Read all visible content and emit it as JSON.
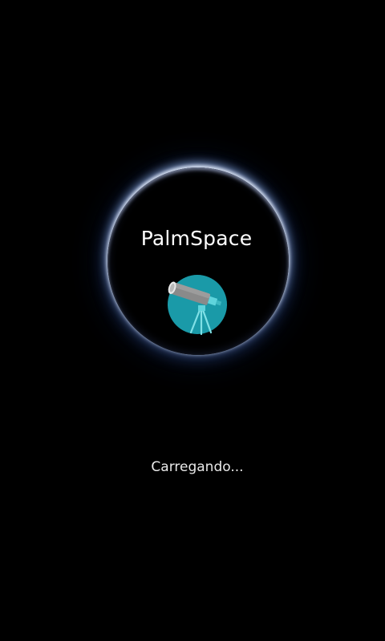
{
  "app": {
    "title": "PalmSpace",
    "logo_icon": "telescope-icon"
  },
  "status": {
    "loading_text": "Carregando..."
  },
  "colors": {
    "background": "#000000",
    "logo_circle": "#1a9aa8",
    "glow": "#9fbaf0",
    "text": "#ffffff"
  }
}
